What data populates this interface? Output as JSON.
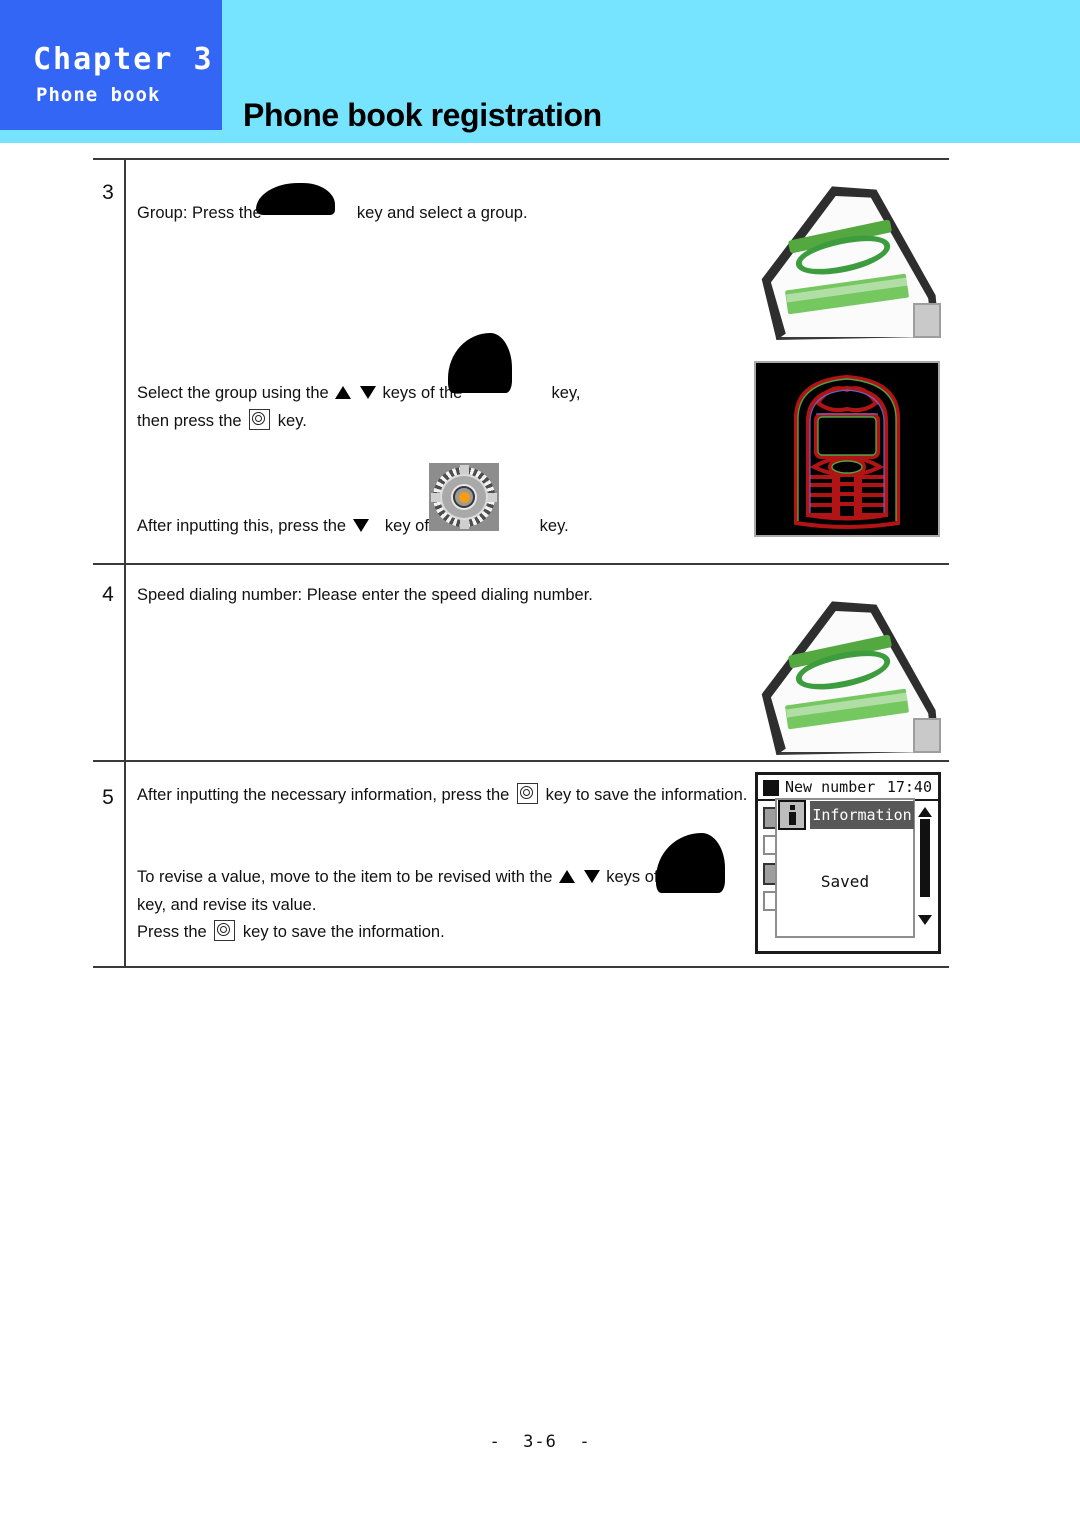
{
  "header": {
    "chapter_label": "Chapter 3",
    "chapter_subtitle": "Phone book",
    "section_title": "Phone book registration",
    "chapter_box_color": "#3366f5",
    "band_color": "#77e4ff"
  },
  "steps": [
    {
      "number": "3",
      "paragraphs": [
        {
          "before": "Group: Press the",
          "after": "key and select a group."
        },
        {
          "before": "Select the group using the",
          "mid": "keys of the",
          "after": "key,"
        },
        {
          "before": "then press the",
          "after": "key."
        },
        {
          "before": "After inputting this, press the",
          "mid": "key of the",
          "after": "key."
        }
      ],
      "figures": [
        "send-key-photo",
        "phone-edge-photo"
      ]
    },
    {
      "number": "4",
      "paragraphs": [
        {
          "text": "Speed dialing number:  Please enter the speed dialing number."
        }
      ],
      "figures": [
        "send-key-photo"
      ]
    },
    {
      "number": "5",
      "paragraphs": [
        {
          "before": "After inputting the necessary information,  press the",
          "after": "key to save the information."
        },
        {
          "before": "To revise a value, move to the item to be revised with the",
          "mid": "keys of the",
          "after": ""
        },
        {
          "text": "key, and revise its value."
        },
        {
          "before": "Press the",
          "after": "key to save the information."
        }
      ],
      "figures": [
        "lcd-saved-screenshot"
      ]
    }
  ],
  "lcd": {
    "title": "New number",
    "time": "17:40",
    "dialog_title": "Information",
    "dialog_message": "Saved",
    "info_icon": "info-icon",
    "battery_icon": "battery-icon",
    "scroll_up_icon": "scroll-up-arrow-icon",
    "scroll_down_icon": "scroll-down-arrow-icon"
  },
  "icons": {
    "up_key": "triangle-up-key-icon",
    "down_key": "triangle-down-key-icon",
    "ok_key": "ok-confirm-key-icon",
    "dpad": "navigation-dpad-key-icon",
    "redacted": "redacted-key-photo"
  },
  "footer": {
    "page_label": "-  3-6  -"
  }
}
